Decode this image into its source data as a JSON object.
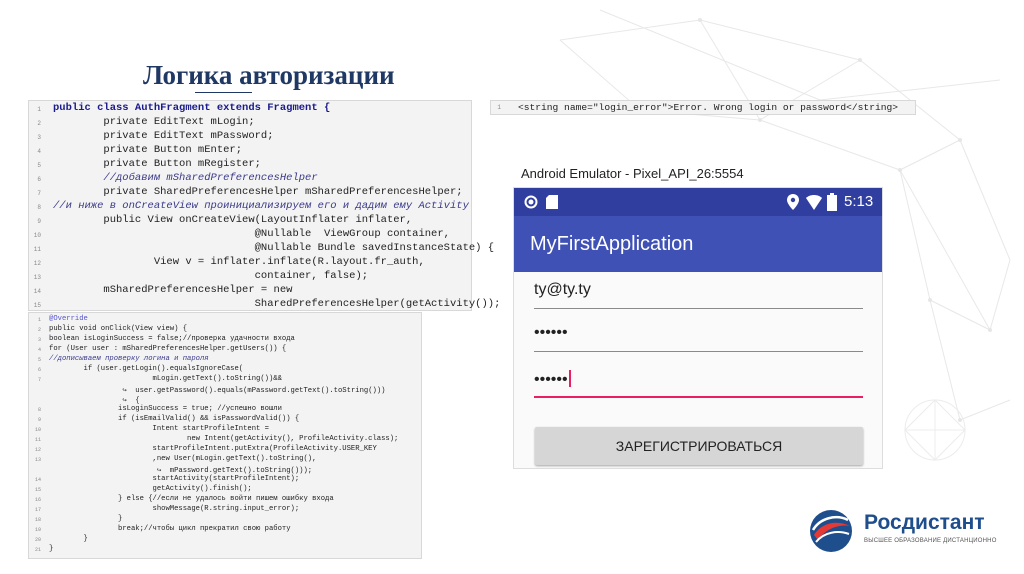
{
  "slide": {
    "title": "Логика авторизации"
  },
  "code_block_1": {
    "line_numbers": [
      "1",
      "2",
      "3",
      "4",
      "5",
      "6",
      "7",
      "8",
      "9",
      "10",
      "11",
      "12",
      "13",
      "14",
      "15"
    ],
    "lines": [
      "public class AuthFragment extends Fragment {",
      "        private EditText mLogin;",
      "        private EditText mPassword;",
      "        private Button mEnter;",
      "        private Button mRegister;",
      "        //добавим mSharedPreferencesHelper",
      "        private SharedPreferencesHelper mSharedPreferencesHelper;",
      "//и ниже в onCreateView проинициализируем его и дадим ему Activity",
      "        public View onCreateView(LayoutInflater inflater,",
      "                                @Nullable  ViewGroup container,",
      "                                @Nullable Bundle savedInstanceState) {",
      "                View v = inflater.inflate(R.layout.fr_auth,",
      "                                container, false);",
      "        mSharedPreferencesHelper = new",
      "                                SharedPreferencesHelper(getActivity());"
    ]
  },
  "code_block_2": {
    "line_numbers": [
      "1",
      "2",
      "3",
      "4",
      "5",
      "6",
      "7",
      "",
      "",
      "8",
      "9",
      "10",
      "11",
      "12",
      "13",
      "",
      "14",
      "15",
      "16",
      "17",
      "18",
      "19",
      "20",
      "21"
    ],
    "lines": [
      "@Override",
      "public void onClick(View view) {",
      "boolean isLoginSuccess = false;//проверка удачности входа",
      "for (User user : mSharedPreferencesHelper.getUsers()) {",
      "//дописываем проверку логина и пароля",
      "        if (user.getLogin().equalsIgnoreCase(",
      "                        mLogin.getText().toString())&&",
      "                 ↪  user.getPassword().equals(mPassword.getText().toString()))",
      "                 ↪  {",
      "                isLoginSuccess = true; //успешно вошли",
      "                if (isEmailValid() && isPasswordValid()) {",
      "                        Intent startProfileIntent =",
      "                                new Intent(getActivity(), ProfileActivity.class);",
      "                        startProfileIntent.putExtra(ProfileActivity.USER_KEY",
      "                        ,new User(mLogin.getText().toString(),",
      "                         ↪  mPassword.getText().toString()));",
      "                        startActivity(startProfileIntent);",
      "                        getActivity().finish();",
      "                } else {//если не удалось войти пишем ошибку входа",
      "                        showMessage(R.string.input_error);",
      "                }",
      "                break;//чтобы цикл прекратил свою работу",
      "        }",
      "}"
    ]
  },
  "code_block_3": {
    "line_number": "1",
    "line": "<string name=\"login_error\">Error. Wrong login or password</string>"
  },
  "emulator": {
    "window_title": "Android Emulator - Pixel_API_26:5554",
    "status_time": "5:13",
    "app_title": "MyFirstApplication",
    "login_value": "ty@ty.ty",
    "password_value": "••••••",
    "password_repeat_value": "••••••",
    "register_button": "ЗАРЕГИСТРИРОВАТЬСЯ",
    "colors": {
      "status_bar": "#303f9f",
      "app_bar": "#3f51b5",
      "accent": "#e91e63"
    }
  },
  "branding": {
    "logo_name": "Росдистант",
    "logo_tagline": "ВЫСШЕЕ ОБРАЗОВАНИЕ ДИСТАНЦИОННО"
  },
  "icons": [
    "circle-icon",
    "sd-card-icon",
    "location-icon",
    "wifi-icon",
    "battery-icon",
    "logo-icon"
  ]
}
